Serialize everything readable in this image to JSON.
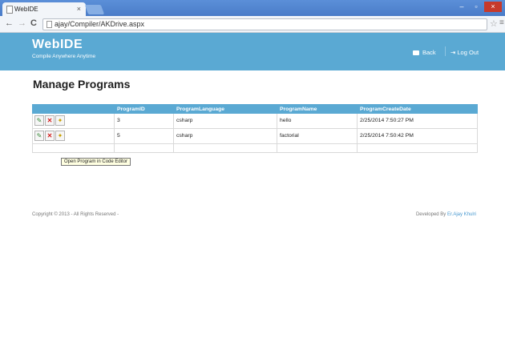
{
  "browser": {
    "tab_title": "WebIDE",
    "tab_close": "×",
    "url": "ajay/Compiler/AKDrive.aspx",
    "back_glyph": "←",
    "forward_glyph": "→",
    "reload_glyph": "C",
    "star_glyph": "☆",
    "menu_glyph": "≡",
    "minimize_glyph": "–",
    "maximize_glyph": "▫",
    "close_glyph": "×"
  },
  "header": {
    "brand": "WebIDE",
    "tagline": "Compile Anywhere Anytime",
    "back_label": "Back",
    "logout_label": "Log Out",
    "accent_color": "#5aa9d3"
  },
  "main": {
    "title": "Manage Programs",
    "columns": [
      "ProgramID",
      "ProgramLanguage",
      "ProgramName",
      "ProgramCreateDate"
    ],
    "rows": [
      {
        "id": "3",
        "language": "csharp",
        "name": "hello",
        "created": "2/25/2014 7:50:27 PM"
      },
      {
        "id": "5",
        "language": "csharp",
        "name": "factorial",
        "created": "2/25/2014 7:50:42 PM"
      }
    ],
    "action_icons": [
      "edit-icon",
      "delete-icon",
      "open-icon"
    ],
    "tooltip": "Open Program in Code Editor"
  },
  "footer": {
    "copyright": "Copyright © 2013 - All Rights Reserved -",
    "developed_by_prefix": "Developed By",
    "author": "Er.Ajay Khulri"
  }
}
